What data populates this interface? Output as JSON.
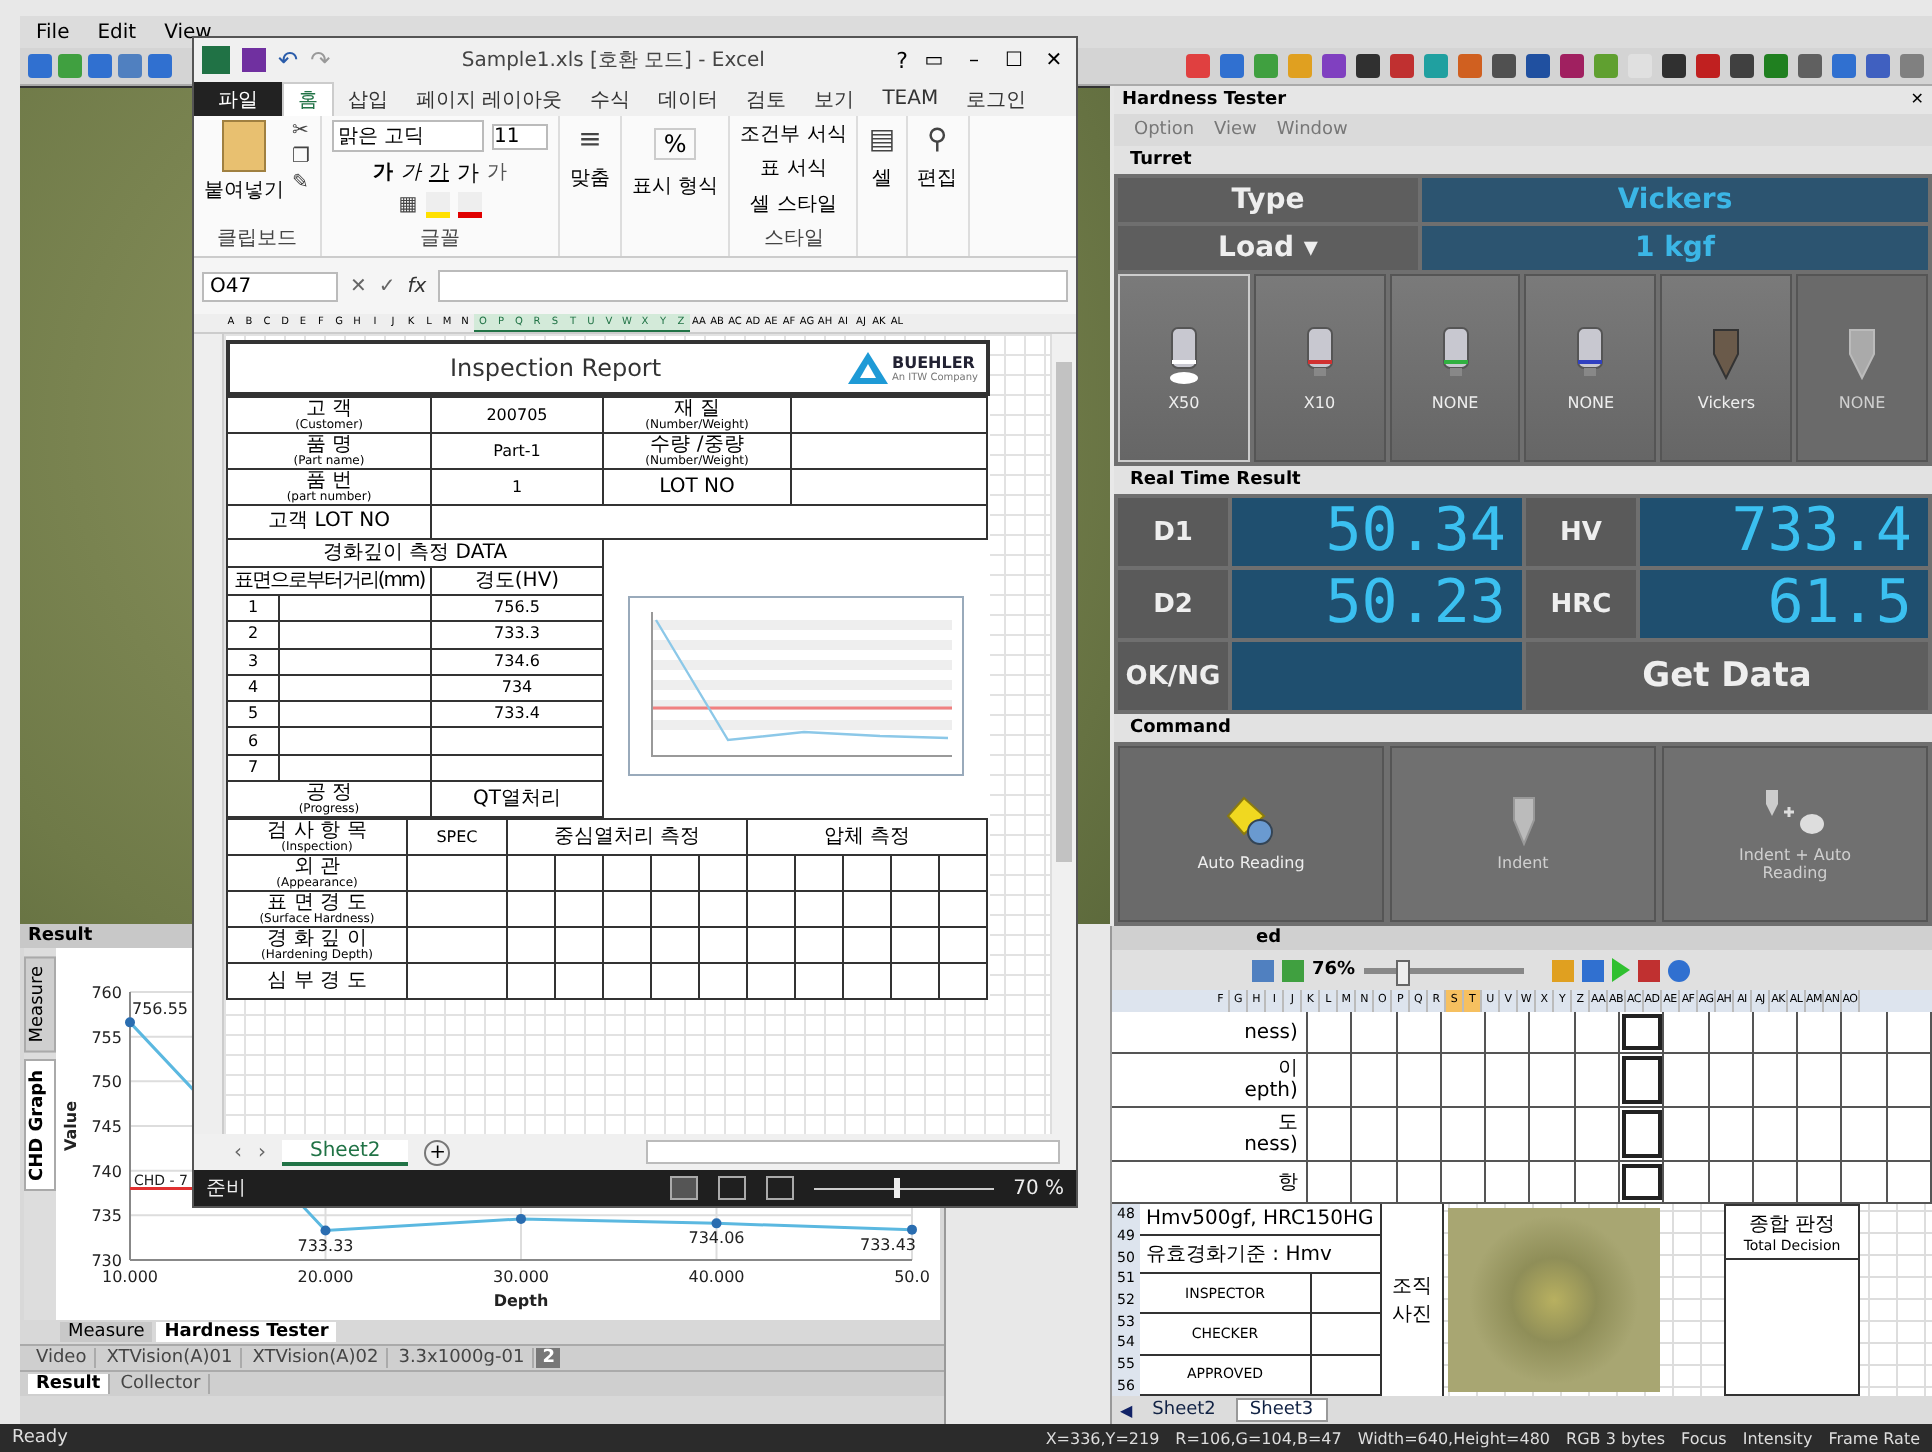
{
  "app_menu": [
    "File",
    "Edit",
    "View"
  ],
  "hardness_tester": {
    "title": "Hardness Tester",
    "panel_buttons": [
      "✕"
    ],
    "menu": [
      "Option",
      "View",
      "Window"
    ],
    "turret": {
      "title": "Turret",
      "type_label": "Type",
      "type_value": "Vickers",
      "load_label": "Load",
      "load_caret": "▾",
      "load_value": "1 kgf",
      "positions": [
        {
          "label": "X50",
          "kind": "objective",
          "color": "#ffffff",
          "selected": true,
          "disabled": false
        },
        {
          "label": "X10",
          "kind": "objective",
          "color": "#d03030",
          "selected": false,
          "disabled": false
        },
        {
          "label": "NONE",
          "kind": "objective",
          "color": "#30b040",
          "selected": false,
          "disabled": false
        },
        {
          "label": "NONE",
          "kind": "objective",
          "color": "#3040c0",
          "selected": false,
          "disabled": false
        },
        {
          "label": "Vickers",
          "kind": "indenter",
          "selected": false,
          "disabled": false
        },
        {
          "label": "NONE",
          "kind": "indenter",
          "selected": false,
          "disabled": true
        }
      ]
    },
    "realtime": {
      "title": "Real Time Result",
      "readings": [
        {
          "label": "D1",
          "value": "50.34"
        },
        {
          "label": "HV",
          "value": "733.4"
        },
        {
          "label": "D2",
          "value": "50.23"
        },
        {
          "label": "HRC",
          "value": "61.5"
        }
      ],
      "ok_ng_label": "OK/NG",
      "get_data": "Get Data"
    },
    "command": {
      "title": "Command",
      "buttons": [
        {
          "label": "Auto Reading",
          "kind": "auto",
          "disabled": false
        },
        {
          "label": "Indent",
          "kind": "indent",
          "disabled": true
        },
        {
          "label": "Indent + Auto Reading",
          "kind": "indent_auto",
          "disabled": true
        }
      ]
    }
  },
  "result_panel": {
    "title": "Result",
    "side_tabs": [
      {
        "label": "Measure",
        "selected": false
      },
      {
        "label": "CHD Graph",
        "selected": true
      }
    ],
    "chart_data": {
      "type": "line",
      "xlabel": "Depth",
      "ylabel": "Value",
      "x": [
        10,
        20,
        30,
        40,
        50
      ],
      "series": [
        {
          "color": "#5bb8e0",
          "marker": true,
          "values": [
            756.6,
            733.3,
            734.6,
            734.1,
            733.4
          ]
        }
      ],
      "xlim": [
        10,
        50
      ],
      "ylim": [
        730,
        760
      ],
      "xticks": [
        {
          "value": 10,
          "label": "10.000"
        },
        {
          "value": 20,
          "label": "20.000"
        },
        {
          "value": 30,
          "label": "30.000"
        },
        {
          "value": 40,
          "label": "40.000"
        },
        {
          "value": 50,
          "label": "50.0"
        }
      ],
      "yticks": [
        730,
        735,
        740,
        745,
        750,
        755,
        760
      ],
      "grid": true,
      "value_labels": [
        "756.55",
        "733.33",
        null,
        "734.06",
        "733.43"
      ],
      "ref_lines": [
        {
          "axis": "y",
          "value": 738,
          "color": "#e03030",
          "label": "CHD - 7"
        }
      ]
    },
    "bottom_tabs": [
      {
        "label": "Measure",
        "selected": false
      },
      {
        "label": "Hardness Tester",
        "selected": true
      }
    ],
    "doc_tabs": [
      {
        "label": "Video",
        "selected": false
      },
      {
        "label": "XTVision(A)01",
        "selected": false
      },
      {
        "label": "XTVision(A)02",
        "selected": false
      },
      {
        "label": "3.3x1000g-01",
        "selected": false
      }
    ],
    "doc_more": "2",
    "view_tabs": [
      {
        "label": "Result",
        "selected": true
      },
      {
        "label": "Collector",
        "selected": false
      }
    ]
  },
  "report_panel": {
    "title": "ed",
    "zoom": "76%",
    "zoom_slider": {
      "level": 0.2
    },
    "columns": [
      {
        "label": "F",
        "selected": false
      },
      {
        "label": "G",
        "selected": false
      },
      {
        "label": "H",
        "selected": false
      },
      {
        "label": "I",
        "selected": false
      },
      {
        "label": "J",
        "selected": false
      },
      {
        "label": "K",
        "selected": false
      },
      {
        "label": "L",
        "selected": false
      },
      {
        "label": "M",
        "selected": false
      },
      {
        "label": "N",
        "selected": false
      },
      {
        "label": "O",
        "selected": false
      },
      {
        "label": "P",
        "selected": false
      },
      {
        "label": "Q",
        "selected": false
      },
      {
        "label": "R",
        "selected": false
      },
      {
        "label": "S",
        "selected": true
      },
      {
        "label": "T",
        "selected": true
      },
      {
        "label": "U",
        "selected": false
      },
      {
        "label": "V",
        "selected": false
      },
      {
        "label": "W",
        "selected": false
      },
      {
        "label": "X",
        "selected": false
      },
      {
        "label": "Y",
        "selected": false
      },
      {
        "label": "Z",
        "selected": false
      },
      {
        "label": "AA",
        "selected": false
      },
      {
        "label": "AB",
        "selected": false
      },
      {
        "label": "AC",
        "selected": false
      },
      {
        "label": "AD",
        "selected": false
      },
      {
        "label": "AE",
        "selected": false
      },
      {
        "label": "AF",
        "selected": false
      },
      {
        "label": "AG",
        "selected": false
      },
      {
        "label": "AH",
        "selected": false
      },
      {
        "label": "AI",
        "selected": false
      },
      {
        "label": "AJ",
        "selected": false
      },
      {
        "label": "AK",
        "selected": false
      },
      {
        "label": "AL",
        "selected": false
      },
      {
        "label": "AM",
        "selected": false
      },
      {
        "label": "AN",
        "selected": false
      },
      {
        "label": "AO",
        "selected": false
      }
    ],
    "upper_rows": [
      [
        "ness)"
      ],
      [
        "이",
        "epth)"
      ],
      [
        "도",
        "ness)"
      ],
      [
        "항"
      ]
    ],
    "row_numbers": [
      "48",
      "49",
      "50",
      "51",
      "52",
      "53",
      "54",
      "55",
      "56"
    ],
    "spec_lines": [
      "Hmv500gf, HRC150HG",
      "유효경화기준 : Hmv"
    ],
    "signoffs": [
      "INSPECTOR",
      "CHECKER",
      "APPROVED"
    ],
    "photo_label": "조직 사진",
    "decision": [
      "종합 판정",
      "Total Decision"
    ],
    "nav": "◀",
    "sheets": [
      {
        "label": "Sheet2",
        "selected": false
      },
      {
        "label": "Sheet3",
        "selected": true
      }
    ]
  },
  "status_bar": {
    "left": "Ready",
    "right": [
      "X=336,Y=219",
      "R=106,G=104,B=47",
      "Width=640,Height=480",
      "RGB 3 bytes",
      "Focus",
      "Intensity",
      "Frame Rate"
    ]
  },
  "excel": {
    "title": "Sample1.xls  [호환 모드] - Excel",
    "quick_access": [
      "↶",
      "↷"
    ],
    "help": "?",
    "window_buttons": [
      "▭",
      "–",
      "☐",
      "✕"
    ],
    "tabs": [
      {
        "label": "파일",
        "kind": "file",
        "selected": false
      },
      {
        "label": "홈",
        "kind": "tab",
        "selected": true
      },
      {
        "label": "삽입",
        "kind": "tab",
        "selected": false
      },
      {
        "label": "페이지 레이아웃",
        "kind": "tab",
        "selected": false
      },
      {
        "label": "수식",
        "kind": "tab",
        "selected": false
      },
      {
        "label": "데이터",
        "kind": "tab",
        "selected": false
      },
      {
        "label": "검토",
        "kind": "tab",
        "selected": false
      },
      {
        "label": "보기",
        "kind": "tab",
        "selected": false
      },
      {
        "label": "TEAM",
        "kind": "tab",
        "selected": false
      },
      {
        "label": "로그인",
        "kind": "tab",
        "selected": false
      }
    ],
    "ribbon": {
      "paste": "붙여넣기",
      "clip_tools": [
        "✂",
        "❐",
        "✎"
      ],
      "clipboard": "클립보드",
      "font_name": "맑은 고딕",
      "font_size": "11",
      "font_buttons": [
        {
          "label": "가",
          "kind": "bold"
        },
        {
          "label": "가",
          "kind": "italic"
        },
        {
          "label": "가",
          "kind": "underline"
        },
        {
          "label": "가",
          "kind": "grow"
        },
        {
          "label": "가",
          "kind": "shrink"
        }
      ],
      "border_glyph": "▦",
      "font_group": "글꼴",
      "align_glyph": "≡",
      "align": "맞춤",
      "number_symbol": "%",
      "number": "표시 형식",
      "styles": [
        "조건부 서식",
        "표 서식",
        "셀 스타일"
      ],
      "styles_group": "스타일",
      "cells_glyph": "▤",
      "cells": "셀",
      "edit_glyph": "⚲",
      "edit": "편집"
    },
    "name_box": "O47",
    "formula_buttons": [
      "✕",
      "✓"
    ],
    "fx": "fx",
    "columns": [
      {
        "label": "A",
        "selected": false
      },
      {
        "label": "B",
        "selected": false
      },
      {
        "label": "C",
        "selected": false
      },
      {
        "label": "D",
        "selected": false
      },
      {
        "label": "E",
        "selected": false
      },
      {
        "label": "F",
        "selected": false
      },
      {
        "label": "G",
        "selected": false
      },
      {
        "label": "H",
        "selected": false
      },
      {
        "label": "I",
        "selected": false
      },
      {
        "label": "J",
        "selected": false
      },
      {
        "label": "K",
        "selected": false
      },
      {
        "label": "L",
        "selected": false
      },
      {
        "label": "M",
        "selected": false
      },
      {
        "label": "N",
        "selected": false
      },
      {
        "label": "O",
        "selected": true
      },
      {
        "label": "P",
        "selected": true
      },
      {
        "label": "Q",
        "selected": true
      },
      {
        "label": "R",
        "selected": true
      },
      {
        "label": "S",
        "selected": true
      },
      {
        "label": "T",
        "selected": true
      },
      {
        "label": "U",
        "selected": true
      },
      {
        "label": "V",
        "selected": true
      },
      {
        "label": "W",
        "selected": true
      },
      {
        "label": "X",
        "selected": true
      },
      {
        "label": "Y",
        "selected": true
      },
      {
        "label": "Z",
        "selected": true
      },
      {
        "label": "AA",
        "selected": false
      },
      {
        "label": "AB",
        "selected": false
      },
      {
        "label": "AC",
        "selected": false
      },
      {
        "label": "AD",
        "selected": false
      },
      {
        "label": "AE",
        "selected": false
      },
      {
        "label": "AF",
        "selected": false
      },
      {
        "label": "AG",
        "selected": false
      },
      {
        "label": "AH",
        "selected": false
      },
      {
        "label": "AI",
        "selected": false
      },
      {
        "label": "AJ",
        "selected": false
      },
      {
        "label": "AK",
        "selected": false
      },
      {
        "label": "AL",
        "selected": false
      }
    ],
    "report": {
      "title": "Inspection Report",
      "logo": "BUEHLER",
      "logo_sub": "An ITW Company",
      "info": [
        [
          {
            "ko": "고    객",
            "en": "(Customer)"
          },
          {
            "v": "200705"
          },
          {
            "ko": "재    질",
            "en": "(Number/Weight)"
          }
        ],
        [
          {
            "ko": "품    명",
            "en": "(Part name)"
          },
          {
            "v": "Part-1"
          },
          {
            "ko": "수량 /중량",
            "en": "(Number/Weight)"
          }
        ],
        [
          {
            "ko": "품    번",
            "en": "(part number)"
          },
          {
            "v": "1"
          },
          {
            "ko": "LOT NO"
          }
        ]
      ],
      "lot_label": "고객 LOT NO",
      "data_title": "경화깊이 측정 DATA",
      "dist_header": "표면으로부터거리(mm)",
      "hv_header": "경도(HV)",
      "data_rows": [
        {
          "n": "1",
          "hv": "756.5"
        },
        {
          "n": "2",
          "hv": "733.3"
        },
        {
          "n": "3",
          "hv": "734.6"
        },
        {
          "n": "4",
          "hv": "734"
        },
        {
          "n": "5",
          "hv": "733.4"
        },
        {
          "n": "6"
        },
        {
          "n": "7"
        }
      ],
      "progress": {
        "ko": "공    정",
        "en": "(Progress)",
        "v": "QT열처리"
      },
      "inspection": {
        "ko": "검 사 항 목",
        "en": "(Inspection)",
        "spec": "SPEC",
        "groups": [
          "중심열처리 측정",
          "압체 측정"
        ]
      },
      "items": [
        {
          "ko": "외    관",
          "en": "(Appearance)"
        },
        {
          "ko": "표 면 경 도",
          "en": "(Surface Hardness)"
        },
        {
          "ko": "경 화 깊 이",
          "en": "(Hardening Depth)"
        },
        {
          "ko": "심 부 경 도"
        }
      ]
    },
    "sheet_nav": [
      "‹",
      "›"
    ],
    "sheet_tab": "Sheet2",
    "add_sheet": "+",
    "status": "준비",
    "zoom": "70 %",
    "zoom_slider": {
      "level": 0.45
    }
  }
}
